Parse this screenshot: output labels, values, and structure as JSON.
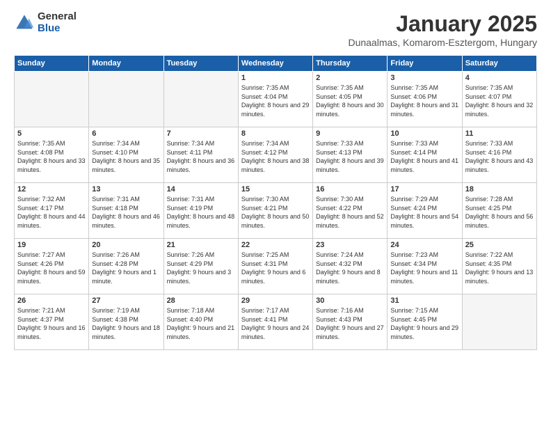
{
  "logo": {
    "general": "General",
    "blue": "Blue"
  },
  "header": {
    "month": "January 2025",
    "location": "Dunaalmas, Komarom-Esztergom, Hungary"
  },
  "weekdays": [
    "Sunday",
    "Monday",
    "Tuesday",
    "Wednesday",
    "Thursday",
    "Friday",
    "Saturday"
  ],
  "weeks": [
    [
      {
        "day": "",
        "info": ""
      },
      {
        "day": "",
        "info": ""
      },
      {
        "day": "",
        "info": ""
      },
      {
        "day": "1",
        "info": "Sunrise: 7:35 AM\nSunset: 4:04 PM\nDaylight: 8 hours and 29 minutes."
      },
      {
        "day": "2",
        "info": "Sunrise: 7:35 AM\nSunset: 4:05 PM\nDaylight: 8 hours and 30 minutes."
      },
      {
        "day": "3",
        "info": "Sunrise: 7:35 AM\nSunset: 4:06 PM\nDaylight: 8 hours and 31 minutes."
      },
      {
        "day": "4",
        "info": "Sunrise: 7:35 AM\nSunset: 4:07 PM\nDaylight: 8 hours and 32 minutes."
      }
    ],
    [
      {
        "day": "5",
        "info": "Sunrise: 7:35 AM\nSunset: 4:08 PM\nDaylight: 8 hours and 33 minutes."
      },
      {
        "day": "6",
        "info": "Sunrise: 7:34 AM\nSunset: 4:10 PM\nDaylight: 8 hours and 35 minutes."
      },
      {
        "day": "7",
        "info": "Sunrise: 7:34 AM\nSunset: 4:11 PM\nDaylight: 8 hours and 36 minutes."
      },
      {
        "day": "8",
        "info": "Sunrise: 7:34 AM\nSunset: 4:12 PM\nDaylight: 8 hours and 38 minutes."
      },
      {
        "day": "9",
        "info": "Sunrise: 7:33 AM\nSunset: 4:13 PM\nDaylight: 8 hours and 39 minutes."
      },
      {
        "day": "10",
        "info": "Sunrise: 7:33 AM\nSunset: 4:14 PM\nDaylight: 8 hours and 41 minutes."
      },
      {
        "day": "11",
        "info": "Sunrise: 7:33 AM\nSunset: 4:16 PM\nDaylight: 8 hours and 43 minutes."
      }
    ],
    [
      {
        "day": "12",
        "info": "Sunrise: 7:32 AM\nSunset: 4:17 PM\nDaylight: 8 hours and 44 minutes."
      },
      {
        "day": "13",
        "info": "Sunrise: 7:31 AM\nSunset: 4:18 PM\nDaylight: 8 hours and 46 minutes."
      },
      {
        "day": "14",
        "info": "Sunrise: 7:31 AM\nSunset: 4:19 PM\nDaylight: 8 hours and 48 minutes."
      },
      {
        "day": "15",
        "info": "Sunrise: 7:30 AM\nSunset: 4:21 PM\nDaylight: 8 hours and 50 minutes."
      },
      {
        "day": "16",
        "info": "Sunrise: 7:30 AM\nSunset: 4:22 PM\nDaylight: 8 hours and 52 minutes."
      },
      {
        "day": "17",
        "info": "Sunrise: 7:29 AM\nSunset: 4:24 PM\nDaylight: 8 hours and 54 minutes."
      },
      {
        "day": "18",
        "info": "Sunrise: 7:28 AM\nSunset: 4:25 PM\nDaylight: 8 hours and 56 minutes."
      }
    ],
    [
      {
        "day": "19",
        "info": "Sunrise: 7:27 AM\nSunset: 4:26 PM\nDaylight: 8 hours and 59 minutes."
      },
      {
        "day": "20",
        "info": "Sunrise: 7:26 AM\nSunset: 4:28 PM\nDaylight: 9 hours and 1 minute."
      },
      {
        "day": "21",
        "info": "Sunrise: 7:26 AM\nSunset: 4:29 PM\nDaylight: 9 hours and 3 minutes."
      },
      {
        "day": "22",
        "info": "Sunrise: 7:25 AM\nSunset: 4:31 PM\nDaylight: 9 hours and 6 minutes."
      },
      {
        "day": "23",
        "info": "Sunrise: 7:24 AM\nSunset: 4:32 PM\nDaylight: 9 hours and 8 minutes."
      },
      {
        "day": "24",
        "info": "Sunrise: 7:23 AM\nSunset: 4:34 PM\nDaylight: 9 hours and 11 minutes."
      },
      {
        "day": "25",
        "info": "Sunrise: 7:22 AM\nSunset: 4:35 PM\nDaylight: 9 hours and 13 minutes."
      }
    ],
    [
      {
        "day": "26",
        "info": "Sunrise: 7:21 AM\nSunset: 4:37 PM\nDaylight: 9 hours and 16 minutes."
      },
      {
        "day": "27",
        "info": "Sunrise: 7:19 AM\nSunset: 4:38 PM\nDaylight: 9 hours and 18 minutes."
      },
      {
        "day": "28",
        "info": "Sunrise: 7:18 AM\nSunset: 4:40 PM\nDaylight: 9 hours and 21 minutes."
      },
      {
        "day": "29",
        "info": "Sunrise: 7:17 AM\nSunset: 4:41 PM\nDaylight: 9 hours and 24 minutes."
      },
      {
        "day": "30",
        "info": "Sunrise: 7:16 AM\nSunset: 4:43 PM\nDaylight: 9 hours and 27 minutes."
      },
      {
        "day": "31",
        "info": "Sunrise: 7:15 AM\nSunset: 4:45 PM\nDaylight: 9 hours and 29 minutes."
      },
      {
        "day": "",
        "info": ""
      }
    ]
  ]
}
